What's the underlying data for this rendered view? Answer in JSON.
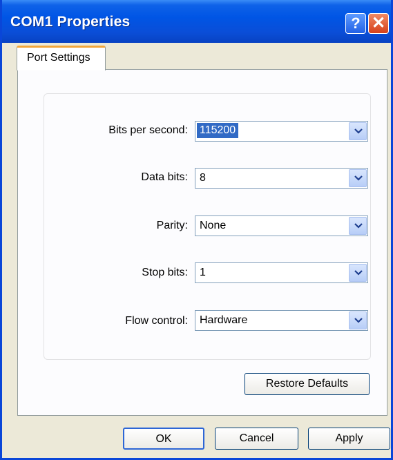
{
  "window": {
    "title": "COM1 Properties"
  },
  "titlebar": {
    "help_label": "?",
    "close_label": "✕"
  },
  "tabs": [
    {
      "label": "Port Settings"
    }
  ],
  "fields": [
    {
      "label": "Bits per second:",
      "value": "115200"
    },
    {
      "label": "Data bits:",
      "value": "8"
    },
    {
      "label": "Parity:",
      "value": "None"
    },
    {
      "label": "Stop bits:",
      "value": "1"
    },
    {
      "label": "Flow control:",
      "value": "Hardware"
    }
  ],
  "buttons": {
    "restore_defaults": "Restore Defaults",
    "ok": "OK",
    "cancel": "Cancel",
    "apply": "Apply"
  },
  "colors": {
    "titlebar": "#0055e5",
    "selection": "#316ac5",
    "tab_accent": "#f2a63a"
  },
  "icons": {
    "help": "help-icon",
    "close": "close-icon",
    "dropdown": "chevron-down-icon"
  }
}
